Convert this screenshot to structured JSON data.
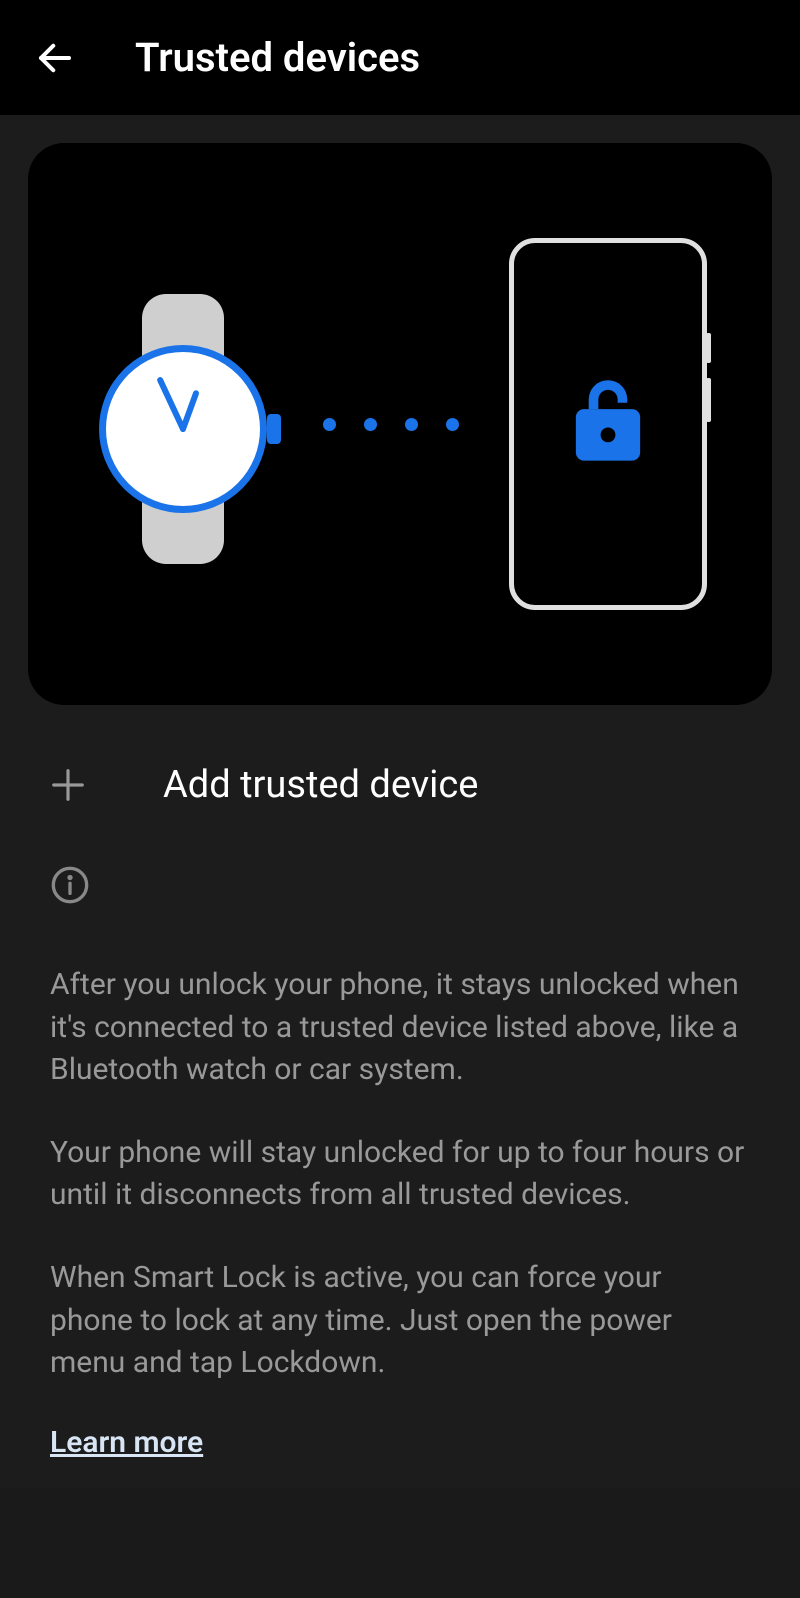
{
  "header": {
    "title": "Trusted devices"
  },
  "actions": {
    "add_label": "Add trusted device"
  },
  "info": {
    "p1": "After you unlock your phone, it stays unlocked when it's connected to a trusted device listed above, like a Bluetooth watch or car system.",
    "p2": "Your phone will stay unlocked for up to four hours or until it disconnects from all trusted devices.",
    "p3": "When Smart Lock is active, you can force your phone to lock at any time. Just open the power menu and tap Lockdown.",
    "learn_more": "Learn more"
  },
  "colors": {
    "accent": "#1a73e8"
  }
}
